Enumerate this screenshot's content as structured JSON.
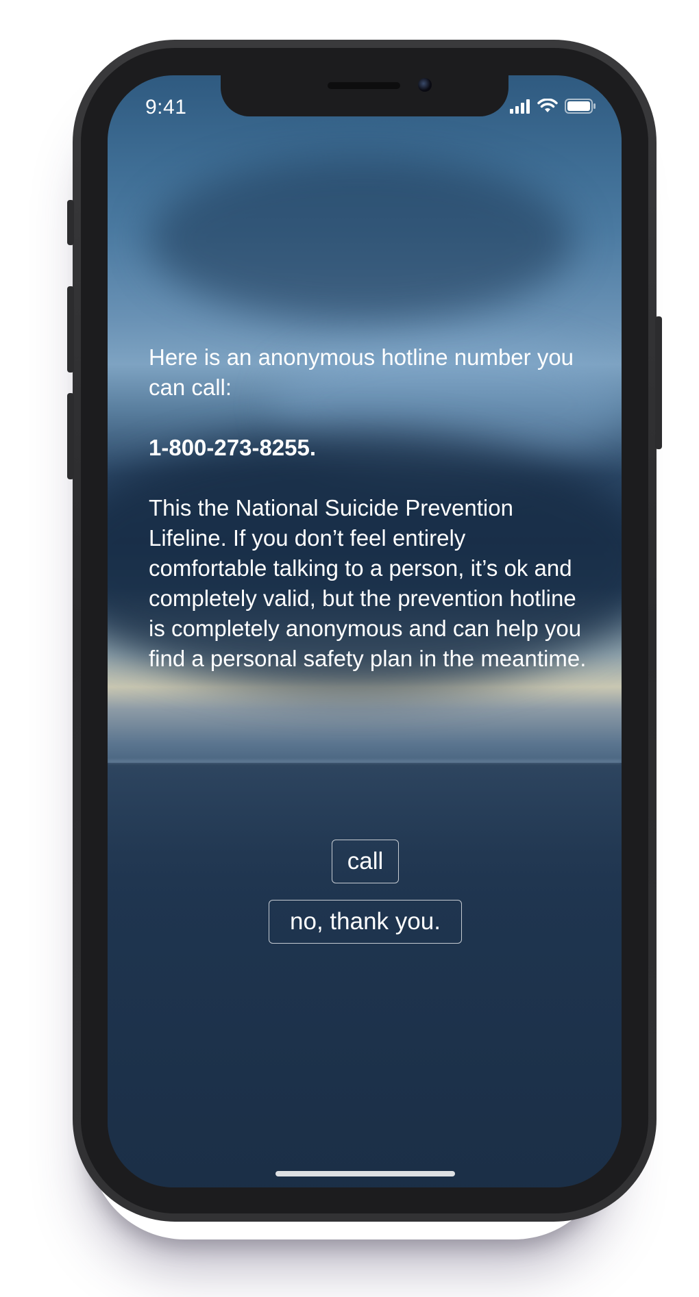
{
  "status_bar": {
    "time": "9:41",
    "icons": [
      "cellular-signal-icon",
      "wifi-icon",
      "battery-icon"
    ]
  },
  "message": {
    "intro": "Here is an anonymous hotline number you can call:",
    "number": "1-800-273-8255.",
    "body": "This the National Suicide Prevention Lifeline. If you don’t feel entirely comfortable talking to a person, it’s ok and completely valid, but the prevention hotline is completely anonymous and can help you find a personal safety plan in the meantime."
  },
  "actions": {
    "call_label": "call",
    "decline_label": "no, thank you."
  },
  "colors": {
    "text": "#ffffff",
    "phone_frame": "#2a2a2c",
    "sky_top": "#2f5a80",
    "sea": "#1b2f47"
  }
}
